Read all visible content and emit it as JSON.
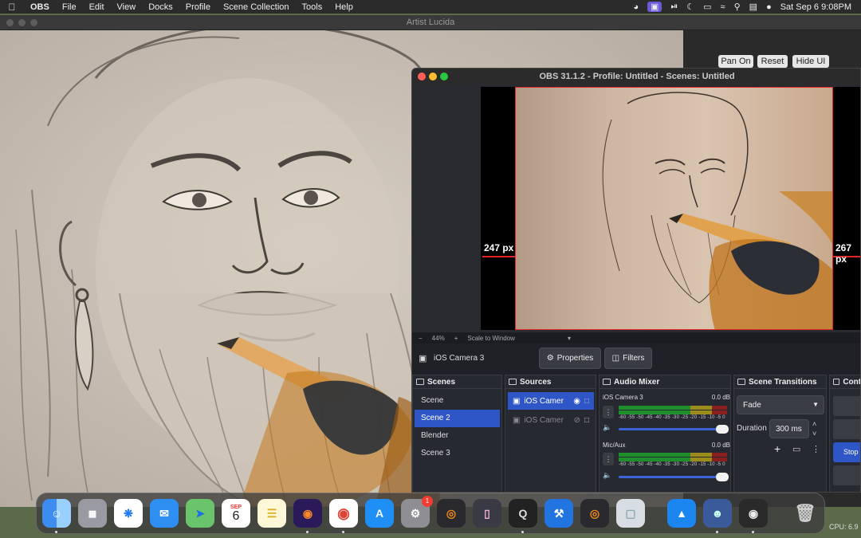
{
  "menubar": {
    "app_name": "OBS",
    "menus": [
      "File",
      "Edit",
      "View",
      "Docks",
      "Profile",
      "Scene Collection",
      "Tools",
      "Help"
    ],
    "clock": "Sat Sep 6  9:08PM"
  },
  "artist": {
    "title": "Artist Lucida",
    "buttons": {
      "pan_on": "Pan On",
      "reset": "Reset",
      "hide_ui": "Hide UI"
    }
  },
  "obs": {
    "title": "OBS 31.1.2 - Profile: Untitled - Scenes: Untitled",
    "measure_left": "247 px",
    "measure_right": "267 px",
    "zoom": {
      "minus": "−",
      "level": "44%",
      "plus": "+",
      "mode": "Scale to Window",
      "dropdown": "▾"
    },
    "selected_source": "iOS Camera 3",
    "properties_label": "Properties",
    "filters_label": "Filters",
    "scenes": {
      "title": "Scenes",
      "items": [
        "Scene",
        "Scene 2",
        "Blender",
        "Scene 3"
      ]
    },
    "sources": {
      "title": "Sources",
      "items": [
        "iOS Camer",
        "iOS Camer"
      ]
    },
    "mixer": {
      "title": "Audio Mixer",
      "channels": [
        {
          "name": "iOS Camera 3",
          "db": "0.0 dB"
        },
        {
          "name": "Mic/Aux",
          "db": "0.0 dB"
        }
      ],
      "scale": "-60 -55 -50 -45 -40 -35 -30 -25 -20 -15 -10  -5   0"
    },
    "transitions": {
      "title": "Scene Transitions",
      "type": "Fade",
      "duration_label": "Duration",
      "duration_value": "300 ms"
    },
    "controls": {
      "title": "Contr",
      "stop_label": "Stop V"
    }
  },
  "dock": {
    "calendar_month": "SEP",
    "calendar_day": "6",
    "settings_badge": "1"
  },
  "cpu": "CPU: 6.9"
}
